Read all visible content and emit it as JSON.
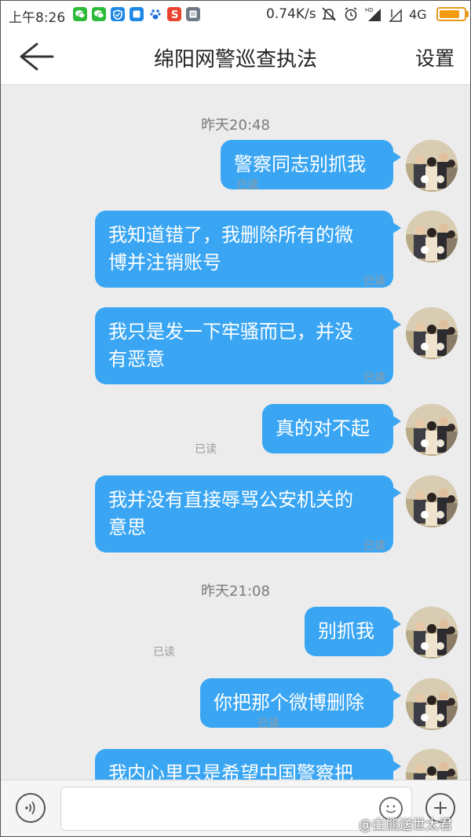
{
  "status_bar": {
    "time": "上午8:26",
    "speed": "0.74K/s",
    "network": "4G",
    "app_icons": [
      {
        "name": "wechat-icon",
        "color": "#2dbb3a"
      },
      {
        "name": "wechat-icon",
        "color": "#2dbb3a"
      },
      {
        "name": "shield-icon",
        "color": "#1e88e5"
      },
      {
        "name": "chat-app-icon",
        "color": "#1e88e5"
      },
      {
        "name": "baidu-paw-icon",
        "color": "#1e6fd9"
      },
      {
        "name": "s-app-icon",
        "color": "#e8442f"
      },
      {
        "name": "notes-icon",
        "color": "#6d7a86"
      }
    ]
  },
  "header": {
    "title": "绵阳网警巡查执法",
    "settings_label": "设置"
  },
  "chat": {
    "bubble_color": "#3aa6f3",
    "timestamps": [
      "昨天20:48",
      "昨天21:08"
    ],
    "messages": [
      {
        "lines": [
          "警察同志别抓我"
        ],
        "read": "已读"
      },
      {
        "lines": [
          "我知道错了，我删除所有的微",
          "博并注销账号"
        ],
        "read": "已读"
      },
      {
        "lines": [
          "我只是发一下牢骚而已，并没",
          "有恶意"
        ],
        "read": "已读"
      },
      {
        "lines": [
          "真的对不起"
        ],
        "read": "已读"
      },
      {
        "lines": [
          "我并没有直接辱骂公安机关的",
          "意思"
        ],
        "read": "已读"
      },
      {
        "lines": [
          "别抓我"
        ],
        "read": "已读"
      },
      {
        "lines": [
          "你把那个微博删除"
        ],
        "read": "已读"
      },
      {
        "lines": [
          "我内心里只是希望中国警察把"
        ],
        "read": ""
      }
    ]
  },
  "input": {
    "placeholder": ""
  },
  "watermark": "@白熊送世太君"
}
